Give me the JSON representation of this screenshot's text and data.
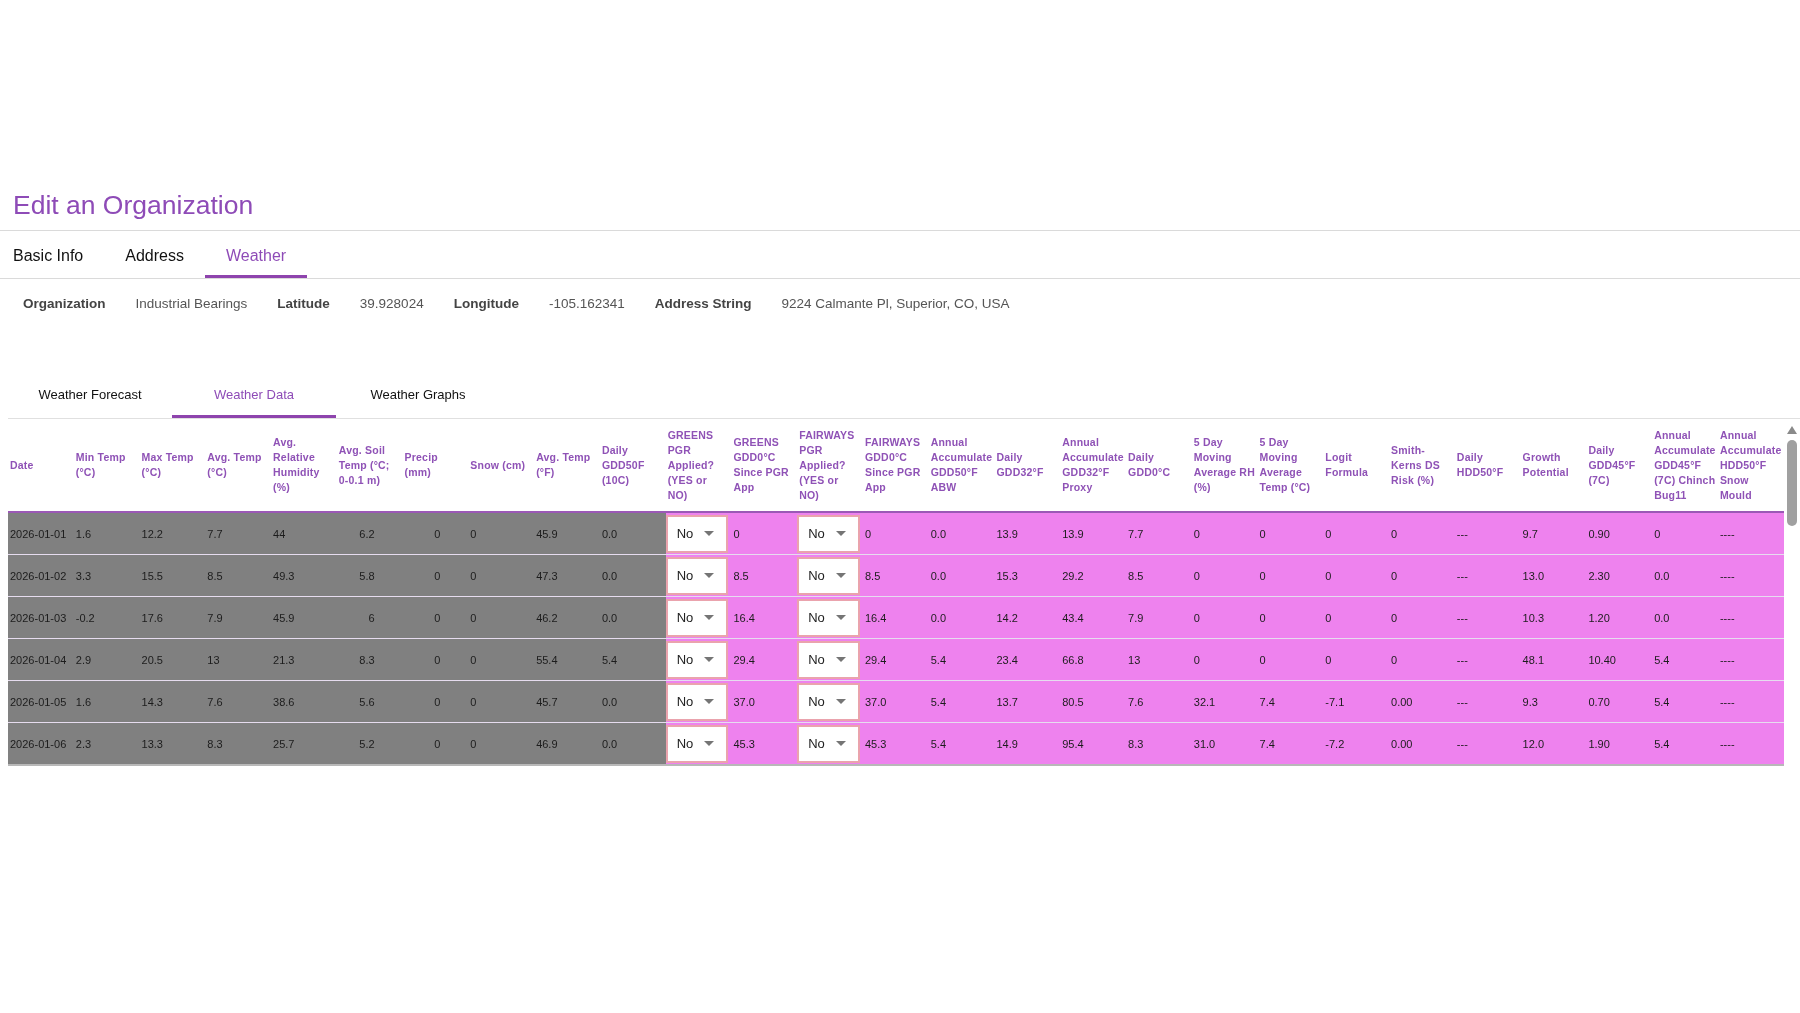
{
  "page": {
    "title": "Edit an Organization"
  },
  "tabs": [
    {
      "label": "Basic Info",
      "selected": false
    },
    {
      "label": "Address",
      "selected": false
    },
    {
      "label": "Weather",
      "selected": true
    }
  ],
  "organization_details": [
    {
      "label": "Organization",
      "value": "Industrial Bearings"
    },
    {
      "label": "Latitude",
      "value": "39.928024"
    },
    {
      "label": "Longitude",
      "value": "-105.162341"
    },
    {
      "label": "Address String",
      "value": "9224 Calmante Pl, Superior, CO, USA"
    }
  ],
  "weather_tabs": [
    {
      "label": "Weather Forecast",
      "selected": false
    },
    {
      "label": "Weather Data",
      "selected": true
    },
    {
      "label": "Weather Graphs",
      "selected": false
    }
  ],
  "table": {
    "column_groups": [
      {
        "color": "#808080",
        "columns": [
          {
            "label": "Date",
            "kind": "plain"
          },
          {
            "label": "Min Temp (°C)",
            "kind": "plain"
          },
          {
            "label": "Max Temp (°C)",
            "kind": "plain"
          },
          {
            "label": "Avg. Temp (°C)",
            "kind": "plain"
          },
          {
            "label": "Avg. Relative Humidity (%)",
            "kind": "plain"
          },
          {
            "label": "Avg. Soil Temp (°C; 0-0.1 m)",
            "kind": "numeric"
          },
          {
            "label": "Precip (mm)",
            "kind": "numeric"
          },
          {
            "label": "Snow (cm)",
            "kind": "plain"
          },
          {
            "label": "Avg. Temp (°F)",
            "kind": "plain"
          },
          {
            "label": "Daily GDD50F (10C)",
            "kind": "plain"
          }
        ]
      },
      {
        "color": "#ee82ee",
        "columns": [
          {
            "label": "GREENS PGR Applied? (YES or NO)",
            "kind": "select"
          },
          {
            "label": "GREENS GDD0°C Since PGR App",
            "kind": "plain"
          },
          {
            "label": "FAIRWAYS PGR Applied? (YES or NO)",
            "kind": "select"
          },
          {
            "label": "FAIRWAYS GDD0°C Since PGR App",
            "kind": "plain"
          },
          {
            "label": "Annual Accumulate GDD50°F ABW",
            "kind": "plain"
          },
          {
            "label": "Daily GDD32°F",
            "kind": "plain"
          },
          {
            "label": "Annual Accumulate GDD32°F Proxy",
            "kind": "plain"
          },
          {
            "label": "Daily GDD0°C",
            "kind": "plain"
          },
          {
            "label": "5 Day Moving Average RH (%)",
            "kind": "plain"
          },
          {
            "label": "5 Day Moving Average Temp (°C)",
            "kind": "plain"
          },
          {
            "label": "Logit Formula",
            "kind": "plain"
          },
          {
            "label": "Smith-Kerns DS Risk (%)",
            "kind": "plain"
          },
          {
            "label": "Daily HDD50°F",
            "kind": "plain"
          },
          {
            "label": "Growth Potential",
            "kind": "plain"
          },
          {
            "label": "Daily GDD45°F (7C)",
            "kind": "plain"
          },
          {
            "label": "Annual Accumulate GDD45°F (7C) Chinch Bug11",
            "kind": "plain"
          },
          {
            "label": "Annual Accumulate HDD50°F Snow Mould",
            "kind": "plain"
          }
        ]
      }
    ],
    "rows": [
      {
        "cells": [
          "2026-01-01",
          "1.6",
          "12.2",
          "7.7",
          "44",
          "6.2",
          "0",
          "0",
          "45.9",
          "0.0",
          "No",
          "0",
          "No",
          "0",
          "0.0",
          "13.9",
          "13.9",
          "7.7",
          "0",
          "0",
          "0",
          "0",
          "---",
          "9.7",
          "0.90",
          "0",
          "----"
        ]
      },
      {
        "cells": [
          "2026-01-02",
          "3.3",
          "15.5",
          "8.5",
          "49.3",
          "5.8",
          "0",
          "0",
          "47.3",
          "0.0",
          "No",
          "8.5",
          "No",
          "8.5",
          "0.0",
          "15.3",
          "29.2",
          "8.5",
          "0",
          "0",
          "0",
          "0",
          "---",
          "13.0",
          "2.30",
          "0.0",
          "----"
        ]
      },
      {
        "cells": [
          "2026-01-03",
          "-0.2",
          "17.6",
          "7.9",
          "45.9",
          "6",
          "0",
          "0",
          "46.2",
          "0.0",
          "No",
          "16.4",
          "No",
          "16.4",
          "0.0",
          "14.2",
          "43.4",
          "7.9",
          "0",
          "0",
          "0",
          "0",
          "---",
          "10.3",
          "1.20",
          "0.0",
          "----"
        ]
      },
      {
        "cells": [
          "2026-01-04",
          "2.9",
          "20.5",
          "13",
          "21.3",
          "8.3",
          "0",
          "0",
          "55.4",
          "5.4",
          "No",
          "29.4",
          "No",
          "29.4",
          "5.4",
          "23.4",
          "66.8",
          "13",
          "0",
          "0",
          "0",
          "0",
          "---",
          "48.1",
          "10.40",
          "5.4",
          "----"
        ]
      },
      {
        "cells": [
          "2026-01-05",
          "1.6",
          "14.3",
          "7.6",
          "38.6",
          "5.6",
          "0",
          "0",
          "45.7",
          "0.0",
          "No",
          "37.0",
          "No",
          "37.0",
          "5.4",
          "13.7",
          "80.5",
          "7.6",
          "32.1",
          "7.4",
          "-7.1",
          "0.00",
          "---",
          "9.3",
          "0.70",
          "5.4",
          "----"
        ]
      },
      {
        "cells": [
          "2026-01-06",
          "2.3",
          "13.3",
          "8.3",
          "25.7",
          "5.2",
          "0",
          "0",
          "46.9",
          "0.0",
          "No",
          "45.3",
          "No",
          "45.3",
          "5.4",
          "14.9",
          "95.4",
          "8.3",
          "31.0",
          "7.4",
          "-7.2",
          "0.00",
          "---",
          "12.0",
          "1.90",
          "5.4",
          "----"
        ]
      }
    ]
  }
}
